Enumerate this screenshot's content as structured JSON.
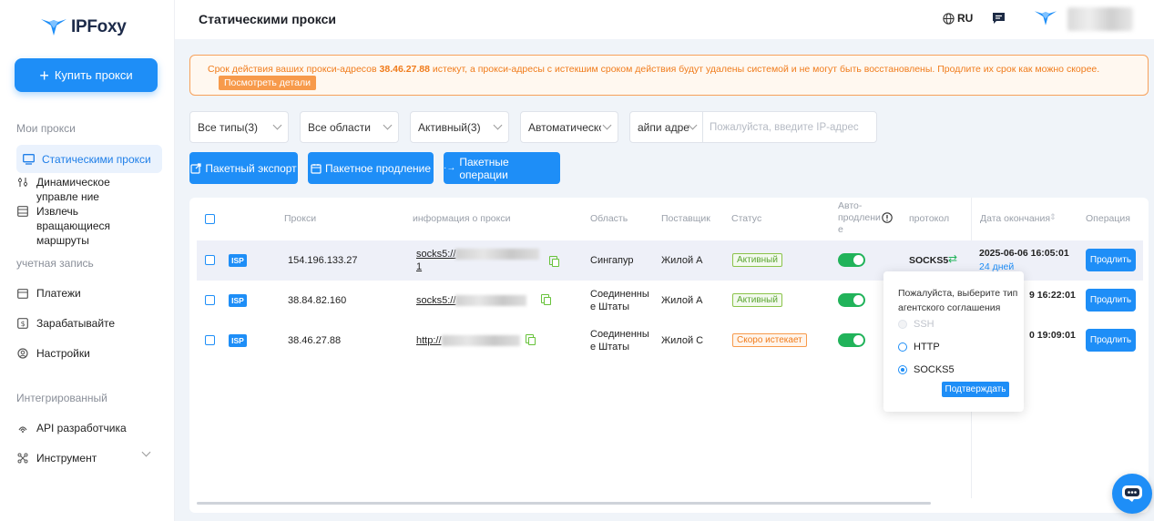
{
  "brand": {
    "name": "IPFoxy"
  },
  "sidebar": {
    "buy_label": "Купить прокси",
    "section_my_proxies": "Мои прокси",
    "items_proxies": [
      {
        "label": "Статическими прокси",
        "icon": "monitor-icon"
      },
      {
        "label": "Динамическое управле ние",
        "icon": "dynamic-icon"
      },
      {
        "label": "Извлечь вращающиеся маршруты",
        "icon": "route-icon"
      }
    ],
    "section_account": "учетная запись",
    "items_account": [
      {
        "label": "Платежи",
        "icon": "wallet-icon"
      },
      {
        "label": "Зарабатывайте",
        "icon": "earn-icon"
      },
      {
        "label": "Настройки",
        "icon": "settings-icon"
      }
    ],
    "section_integrated": "Интегрированный",
    "items_integrated": [
      {
        "label": "API разработчика",
        "icon": "api-icon"
      },
      {
        "label": "Инструмент",
        "icon": "tool-icon"
      }
    ]
  },
  "header": {
    "title": "Статическими прокси",
    "lang": "RU"
  },
  "alert": {
    "text_before": "Срок действия ваших прокси-адресов ",
    "ip": "38.46.27.88",
    "text_after": " истекут, а прокси-адресы с истекшим сроком действия будут удалены системой и не могут быть восстановлены. Продлите их срок как можно скорее.",
    "details_label": "Посмотреть детали"
  },
  "filters": {
    "type": "Все типы(3)",
    "region": "Все области",
    "status": "Активный(3)",
    "renew": "Автоматическо",
    "ip_mode": "айпи адре",
    "ip_placeholder": "Пожалуйста, введите IP-адрес"
  },
  "actions": {
    "export": "Пакетный экспорт",
    "renew": "Пакетное продление",
    "operations": "Пакетные операции"
  },
  "table": {
    "headers": {
      "proxy": "Прокси",
      "info": "информация о прокси",
      "region": "Область",
      "provider": "Поставщик",
      "status": "Статус",
      "auto_renew": "Авто-продлени е",
      "protocol": "протокол",
      "expiry": "Дата окончания",
      "operation": "Операция"
    },
    "rows": [
      {
        "tag": "ISP",
        "ip": "154.196.133.27",
        "info_prefix": "socks5://",
        "info_suffix": "1",
        "region": "Сингапур",
        "provider": "Жилой A",
        "status": "Активный",
        "protocol": "SOCKS5",
        "expiry": "2025-06-06 16:05:01",
        "days": "24 дней",
        "renew": "Продлить"
      },
      {
        "tag": "ISP",
        "ip": "38.84.82.160",
        "info_prefix": "socks5://",
        "region": "Соединенны е Штаты",
        "provider": "Жилой A",
        "status": "Активный",
        "expiry_tail": "9 16:22:01",
        "renew": "Продлить"
      },
      {
        "tag": "ISP",
        "ip": "38.46.27.88",
        "info_prefix": "http://",
        "region": "Соединенны е Штаты",
        "provider": "Жилой C",
        "status": "Скоро истекает",
        "expiry_tail": "0 19:09:01",
        "renew": "Продлить"
      }
    ]
  },
  "popover": {
    "title": "Пожалуйста, выберите тип агентского соглашения",
    "options": [
      {
        "label": "SSH",
        "state": "disabled"
      },
      {
        "label": "HTTP",
        "state": "unchecked"
      },
      {
        "label": "SOCKS5",
        "state": "checked"
      }
    ],
    "confirm": "Подтверждать"
  },
  "colors": {
    "accent": "#1e8ef7",
    "warning": "#f07c1c",
    "success": "#21b35a"
  }
}
